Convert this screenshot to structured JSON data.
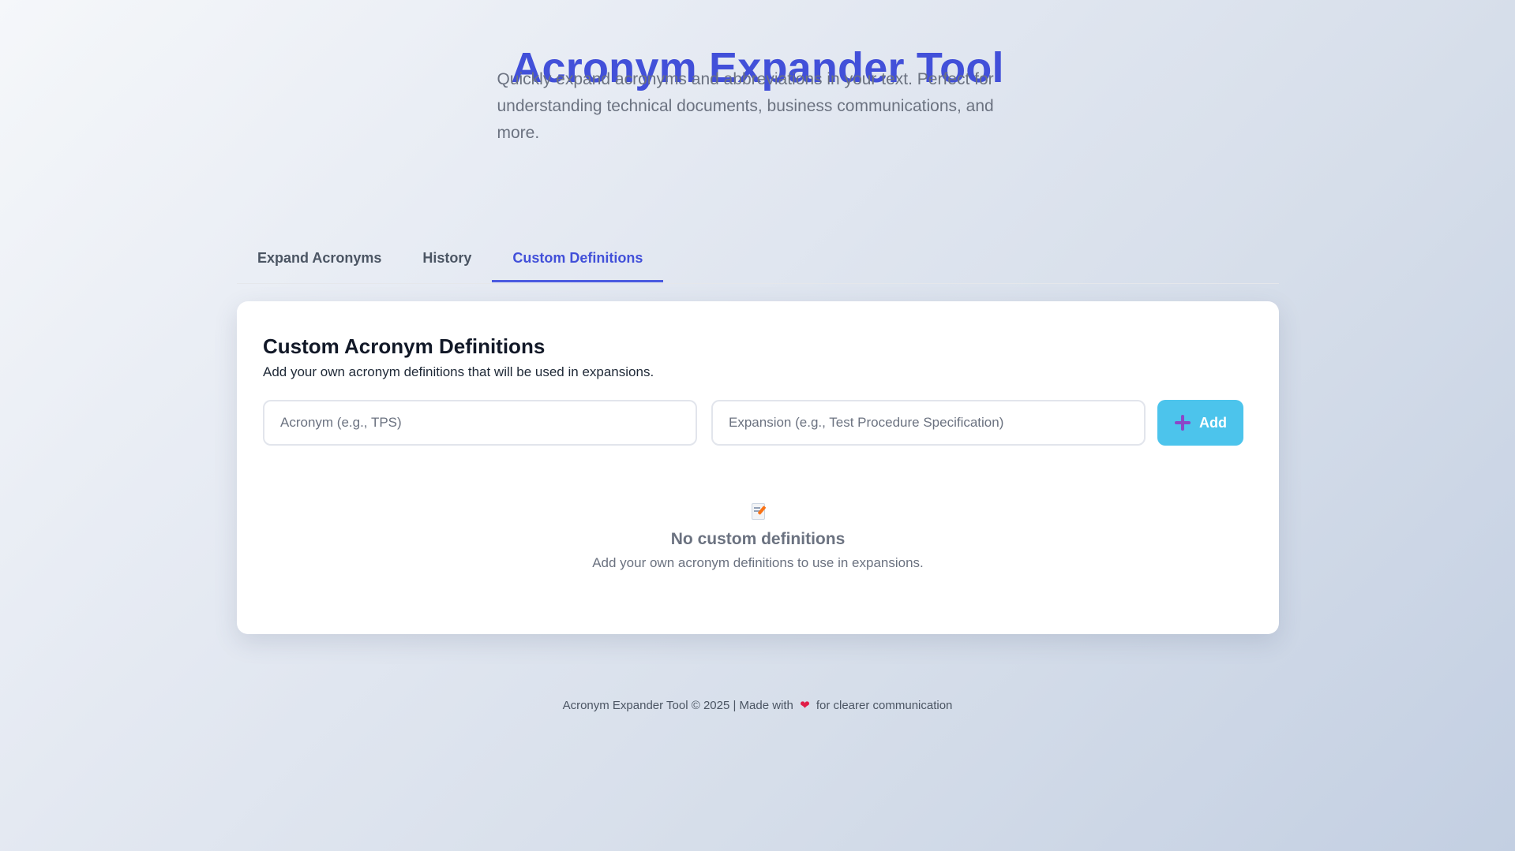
{
  "header": {
    "title": "Acronym Expander Tool",
    "subtitle": "Quickly expand acronyms and abbreviations in your text. Perfect for understanding technical documents, business communications, and more."
  },
  "tabs": [
    {
      "label": "Expand Acronyms",
      "active": false
    },
    {
      "label": "History",
      "active": false
    },
    {
      "label": "Custom Definitions",
      "active": true
    }
  ],
  "custom_definitions": {
    "title": "Custom Acronym Definitions",
    "description": "Add your own acronym definitions that will be used in expansions.",
    "acronym_input": {
      "value": "",
      "placeholder": "Acronym (e.g., TPS)"
    },
    "expansion_input": {
      "value": "",
      "placeholder": "Expansion (e.g., Test Procedure Specification)"
    },
    "add_button": {
      "label": "Add",
      "icon": "plus-icon"
    },
    "empty_state": {
      "icon": "memo-icon",
      "title": "No custom definitions",
      "description": "Add your own acronym definitions to use in expansions."
    }
  },
  "footer": {
    "prefix": "Acronym Expander Tool © 2025 | Made with",
    "heart": "❤",
    "suffix": "for clearer communication"
  },
  "colors": {
    "accent": "#4250d9",
    "add_button": "#4cc4ec",
    "muted_text": "#6b7280"
  }
}
